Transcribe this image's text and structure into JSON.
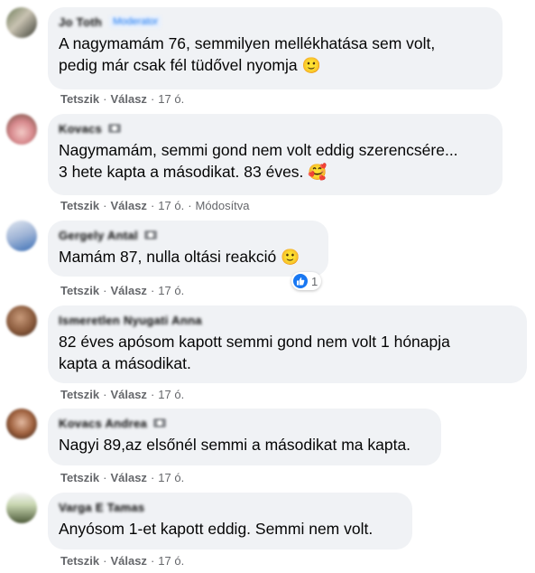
{
  "actions": {
    "like": "Tetszik",
    "reply": "Válasz",
    "separator": "·",
    "edited": "Módosítva"
  },
  "comments": [
    {
      "author": "Jo Toth",
      "badge": "Moderator",
      "lines": [
        "A nagymamám 76, semmilyen mellékhatása sem volt,",
        "pedig már csak fél tüdővel nyomja"
      ],
      "emoji": "🙂",
      "time": "17 ó."
    },
    {
      "author": "Kovacs",
      "lines": [
        "Nagymamám, semmi gond nem volt eddig szerencsére...",
        "3 hete kapta a másodikat. 83 éves."
      ],
      "emoji": "🥰",
      "time": "17 ó."
    },
    {
      "author": "Gergely Antal",
      "lines": [
        "Mamám 87, nulla oltási reakció"
      ],
      "emoji": "🙂",
      "time": "17 ó.",
      "reaction_count": "1"
    },
    {
      "author": "Ismeretlen Nyugati Anna",
      "lines": [
        "82 éves apósom kapott semmi gond nem volt 1 hónapja",
        "kapta a másodikat."
      ],
      "time": "17 ó."
    },
    {
      "author": "Kovacs Andrea",
      "lines": [
        "Nagyi 89,az elsőnél semmi a másodikat ma kapta."
      ],
      "time": "17 ó."
    },
    {
      "author": "Varga E Tamas",
      "lines": [
        "Anyósom 1-et kapott eddig. Semmi nem volt."
      ],
      "time": "17 ó."
    }
  ],
  "colors": {
    "bubble": "#f0f2f5",
    "meta_text": "#65676b",
    "like_blue": "#1877f2"
  }
}
